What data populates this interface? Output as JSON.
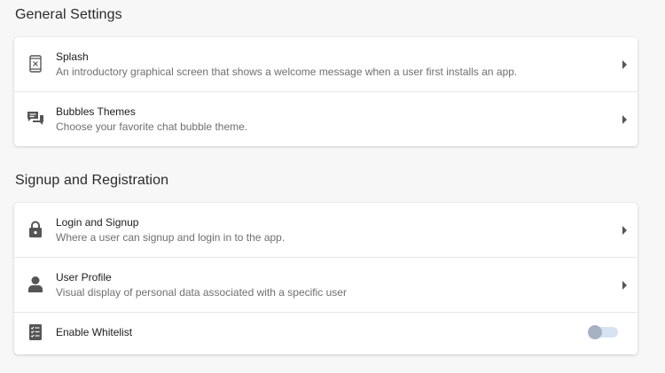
{
  "sections": [
    {
      "title": "General Settings",
      "items": [
        {
          "icon": "phone-screen-icon",
          "title": "Splash",
          "description": "An introductory graphical screen that shows a welcome message when a user first installs an app."
        },
        {
          "icon": "chat-bubbles-icon",
          "title": "Bubbles Themes",
          "description": "Choose your favorite chat bubble theme."
        }
      ]
    },
    {
      "title": "Signup and Registration",
      "items": [
        {
          "icon": "lock-icon",
          "title": "Login and Signup",
          "description": "Where a user can signup and login in to the app."
        },
        {
          "icon": "user-icon",
          "title": "User Profile",
          "description": "Visual display of personal data associated with a specific user"
        },
        {
          "icon": "checklist-icon",
          "title": "Enable Whitelist",
          "toggle_state": "off"
        }
      ]
    }
  ],
  "colors": {
    "background": "#f7f7f7",
    "card": "#ffffff",
    "toggle_track": "#d6e3f2",
    "toggle_thumb": "#a7b1c4",
    "icon": "#5a5a5a"
  }
}
